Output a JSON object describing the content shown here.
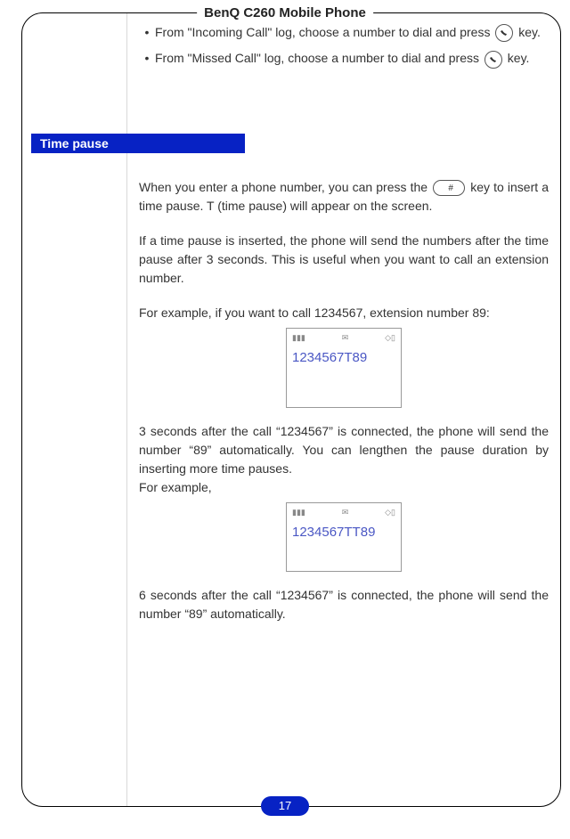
{
  "header": {
    "title": "BenQ C260 Mobile Phone"
  },
  "bullets": {
    "b1a": "From \"Incoming Call\" log, choose a number to dial and press ",
    "b1b": " key.",
    "b2a": "From \"Missed Call\" log, choose a number to dial and press ",
    "b2b": " key."
  },
  "section": {
    "title": "Time pause"
  },
  "body": {
    "p1a": "When you enter a phone number, you can press the ",
    "p1b": " key to insert a time pause. T (time pause) will appear on the screen.",
    "p2": "If a time pause is inserted, the phone will send the numbers after the time pause after 3 seconds. This is useful when you want to call an extension number.",
    "p3": "For example, if you want to call 1234567, extension number 89:",
    "screen1": "1234567T89",
    "p4": "3 seconds after the call “1234567” is connected, the phone will send the number “89” automatically. You can lengthen the pause duration by inserting more time pauses.",
    "p5": "For example,",
    "screen2": "1234567TT89",
    "p6": "6 seconds after the call “1234567” is connected, the phone will send the number “89” automatically."
  },
  "hashKeyLabel": "#",
  "pageNumber": "17",
  "statusIcons": {
    "signal": "▮▮▮",
    "msg": "✉",
    "battery": "◇▯"
  }
}
